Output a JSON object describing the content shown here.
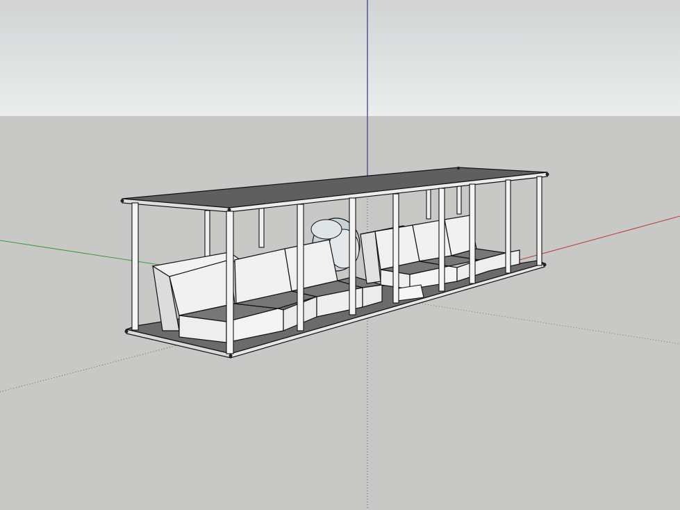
{
  "app": {
    "viewport": "sketchup-3d-model-view"
  },
  "colors": {
    "sky_top": "#d4d5d6",
    "sky_bottom": "#e9ebeb",
    "ground": "#c8c8c6",
    "axis_red": "#b83a3a",
    "axis_green": "#3c9a3c",
    "axis_blue": "#35357a",
    "edge": "#1a1a1a",
    "roof_top": "#5f5f5f",
    "floor_top": "#6a6a6a",
    "seat_face": "#f1f1f1",
    "seat_side": "#dddddd",
    "seat_top": "#777777",
    "post_face": "#f4f4f4",
    "fan_fill": "#c9d0d6"
  },
  "scene": {
    "objects": [
      "axis-origin",
      "red-axis",
      "green-axis",
      "blue-axis",
      "pergola-roof",
      "pergola-floor",
      "posts",
      "sofa-sections",
      "fan-object"
    ]
  }
}
